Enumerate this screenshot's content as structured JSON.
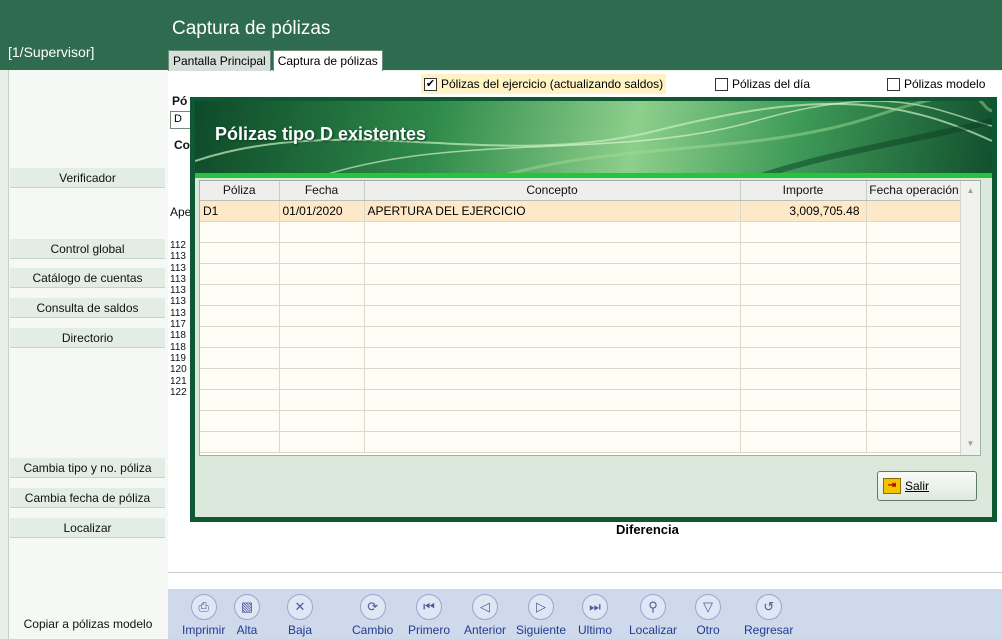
{
  "header": {
    "user": "[1/Supervisor]",
    "title": "Captura de pólizas",
    "tabs": [
      {
        "label": "Pantalla Principal",
        "active": false
      },
      {
        "label": "Captura de pólizas",
        "active": true
      }
    ]
  },
  "options": {
    "ejercicio": {
      "label": "Pólizas del ejercicio (actualizando saldos)",
      "checked": true
    },
    "dia": {
      "label": "Pólizas del día",
      "checked": false
    },
    "modelo": {
      "label": "Pólizas modelo",
      "checked": false
    }
  },
  "sidebar": {
    "items": [
      "Verificador",
      "Control global",
      "Catálogo de cuentas",
      "Consulta de saldos",
      "Directorio",
      "Cambia tipo y no. póliza",
      "Cambia fecha de póliza",
      "Localizar"
    ],
    "bottom_item": "Copiar a pólizas modelo"
  },
  "behind": {
    "poliza_label": "Pó",
    "poliza_value": "D",
    "co_label": "Co",
    "ape_label": "Ape",
    "account_rows": [
      "112",
      "113",
      "113",
      "113",
      "113",
      "113",
      "113",
      "117",
      "118",
      "118",
      "119",
      "120",
      "121",
      "122"
    ],
    "diferencia_label": "Diferencia"
  },
  "modal": {
    "title": "Pólizas tipo D existentes",
    "columns": [
      "Póliza",
      "Fecha",
      "Concepto",
      "Importe",
      "Fecha operación"
    ],
    "rows": [
      {
        "poliza": "D1",
        "fecha": "01/01/2020",
        "concepto": "APERTURA DEL EJERCICIO",
        "importe": "3,009,705.48",
        "fecha_operacion": ""
      }
    ],
    "empty_row_count": 11,
    "salir_label": "Salir",
    "colors": {
      "frame": "#0f5834",
      "accent_strip": "#27c33a",
      "selected_row": "#fde9c8"
    }
  },
  "toolbar": {
    "buttons": [
      {
        "label": "Imprimir",
        "icon": "printer-icon"
      },
      {
        "label": "Alta",
        "icon": "add-document-icon"
      },
      {
        "label": "Baja",
        "icon": "delete-document-icon"
      },
      {
        "label": "Cambio",
        "icon": "refresh-icon"
      },
      {
        "label": "Primero",
        "icon": "first-record-icon"
      },
      {
        "label": "Anterior",
        "icon": "previous-record-icon"
      },
      {
        "label": "Siguiente",
        "icon": "next-record-icon"
      },
      {
        "label": "Ultimo",
        "icon": "last-record-icon"
      },
      {
        "label": "Localizar",
        "icon": "search-icon"
      },
      {
        "label": "Otro",
        "icon": "down-triangle-icon"
      },
      {
        "label": "Regresar",
        "icon": "undo-icon"
      }
    ]
  }
}
